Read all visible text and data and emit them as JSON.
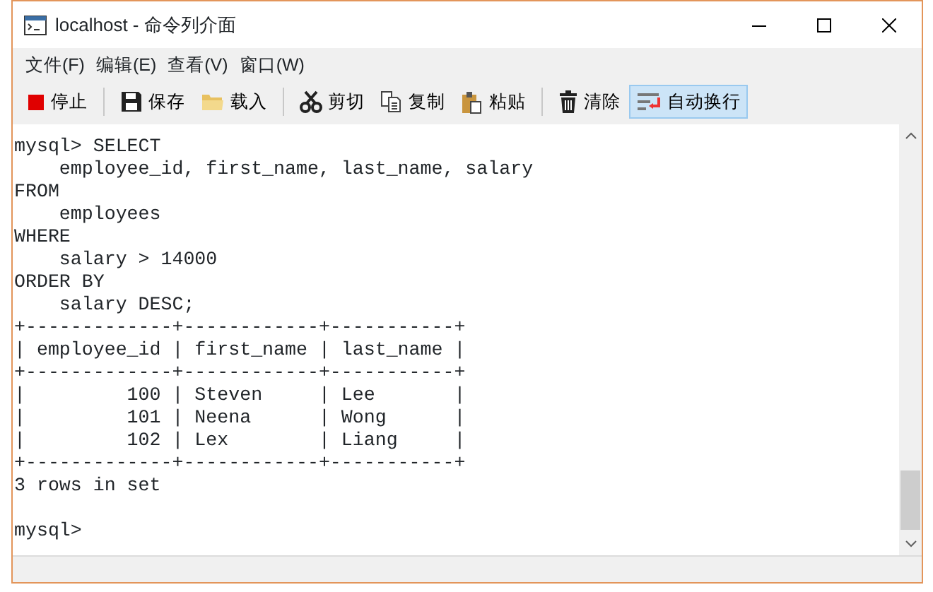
{
  "window": {
    "title": "localhost - 命令列介面"
  },
  "menu": [
    "文件(F)",
    "编辑(E)",
    "查看(V)",
    "窗口(W)"
  ],
  "toolbar": [
    [
      {
        "kind": "stop",
        "label": "停止",
        "pressed": false
      }
    ],
    [
      {
        "kind": "save",
        "label": "保存",
        "pressed": false
      },
      {
        "kind": "load",
        "label": "载入",
        "pressed": false
      }
    ],
    [
      {
        "kind": "cut",
        "label": "剪切",
        "pressed": false
      },
      {
        "kind": "copy",
        "label": "复制",
        "pressed": false
      },
      {
        "kind": "paste",
        "label": "粘贴",
        "pressed": false
      }
    ],
    [
      {
        "kind": "clear",
        "label": "清除",
        "pressed": false
      },
      {
        "kind": "wrap",
        "label": "自动换行",
        "pressed": true
      }
    ]
  ],
  "console": {
    "blocks": [
      [
        "mysql> SELECT",
        "    employee_id, first_name, last_name, salary",
        "FROM",
        "    employees",
        "WHERE",
        "    salary > 14000",
        "ORDER BY",
        "    salary DESC;",
        "+-------------+------------+-----------+",
        "| employee_id | first_name | last_name |",
        "+-------------+------------+-----------+",
        "|         100 | Steven     | Lee       |",
        "|         101 | Neena      | Wong      |",
        "|         102 | Lex        | Liang     |",
        "+-------------+------------+-----------+",
        "3 rows in set"
      ],
      [
        "mysql>"
      ]
    ]
  }
}
